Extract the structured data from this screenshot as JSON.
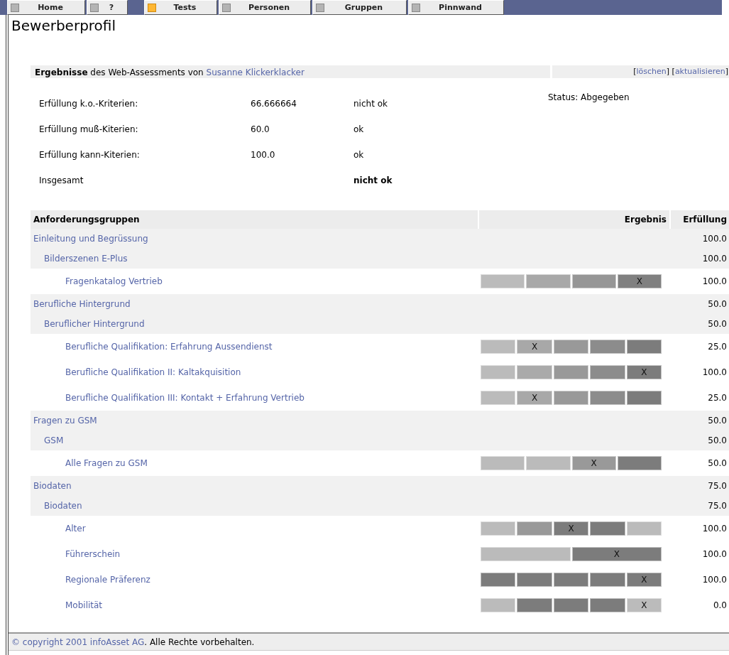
{
  "tab_groups": [
    [
      {
        "label": "Home",
        "selected": false
      },
      {
        "label": "?",
        "selected": false
      }
    ],
    [
      {
        "label": "Tests",
        "selected": true
      },
      {
        "label": "Personen",
        "selected": false
      },
      {
        "label": "Gruppen",
        "selected": false
      },
      {
        "label": "Pinnwand",
        "selected": false
      }
    ]
  ],
  "title": "Bewerberprofil",
  "result_header": {
    "intro": "**Ergebnisse** des Web-Assessments von ",
    "person": "Susanne Klickerklacker",
    "actions": [
      {
        "open": "[",
        "label": "löschen",
        "close": "]"
      },
      {
        "open": "[",
        "label": "aktualisieren",
        "close": "]"
      }
    ]
  },
  "summary": [
    {
      "kind": "criterion",
      "label": "Erfüllung k.o.-Kriterien:",
      "value": "66.666664",
      "verdict": "nicht ok"
    },
    {
      "kind": "criterion",
      "label": "Erfüllung muß-Kiterien:",
      "value": "60.0",
      "verdict": "ok"
    },
    {
      "kind": "criterion",
      "label": "Erfüllung kann-Kiterien:",
      "value": "100.0",
      "verdict": "ok"
    },
    {
      "kind": "total",
      "label": "Insgesamt",
      "verdict": "nicht ok"
    }
  ],
  "status": "Status: Abgegeben",
  "table": {
    "columns": [
      "Anforderungsgruppen",
      "Ergebnis",
      "Erfüllung"
    ],
    "rows": [
      {
        "name": "Einleitung und Begrüssung",
        "score": "100.0",
        "children": [
          {
            "name": "Bilderszenen E-Plus",
            "score": "100.0",
            "children": [
              {
                "name": "Fragenkatalog Vertrieb",
                "score": "100.0",
                "scale": [
                  {
                    "color": "#bbbbbb"
                  },
                  {
                    "color": "#a8a8a8"
                  },
                  {
                    "color": "#969696"
                  },
                  {
                    "color": "#808080",
                    "mark": "X"
                  }
                ]
              }
            ]
          }
        ]
      },
      {
        "name": "Berufliche Hintergrund",
        "score": "50.0",
        "children": [
          {
            "name": "Beruflicher Hintergrund",
            "score": "50.0",
            "children": [
              {
                "name": "Berufliche Qualifikation: Erfahrung Aussendienst",
                "score": "25.0",
                "scale": [
                  {
                    "color": "#bbbbbb"
                  },
                  {
                    "color": "#a8a8a8",
                    "mark": "X"
                  },
                  {
                    "color": "#999999"
                  },
                  {
                    "color": "#8c8c8c"
                  },
                  {
                    "color": "#7c7c7c"
                  }
                ]
              },
              {
                "name": "Berufliche Qualifikation II: Kaltakquisition",
                "score": "100.0",
                "scale": [
                  {
                    "color": "#bbbbbb"
                  },
                  {
                    "color": "#aaaaaa"
                  },
                  {
                    "color": "#999999"
                  },
                  {
                    "color": "#8c8c8c"
                  },
                  {
                    "color": "#7c7c7c",
                    "mark": "X"
                  }
                ]
              },
              {
                "name": "Berufliche Qualifikation III: Kontakt + Erfahrung Vertrieb",
                "score": "25.0",
                "scale": [
                  {
                    "color": "#bbbbbb"
                  },
                  {
                    "color": "#a8a8a8",
                    "mark": "X"
                  },
                  {
                    "color": "#999999"
                  },
                  {
                    "color": "#8c8c8c"
                  },
                  {
                    "color": "#7c7c7c"
                  }
                ]
              }
            ]
          }
        ]
      },
      {
        "name": "Fragen zu GSM",
        "score": "50.0",
        "children": [
          {
            "name": "GSM",
            "score": "50.0",
            "children": [
              {
                "name": "Alle Fragen zu GSM",
                "score": "50.0",
                "scale": [
                  {
                    "color": "#bbbbbb"
                  },
                  {
                    "color": "#bbbbbb"
                  },
                  {
                    "color": "#999999",
                    "mark": "X"
                  },
                  {
                    "color": "#7c7c7c"
                  }
                ]
              }
            ]
          }
        ]
      },
      {
        "name": "Biodaten",
        "score": "75.0",
        "children": [
          {
            "name": "Biodaten",
            "score": "75.0",
            "children": [
              {
                "name": "Alter",
                "score": "100.0",
                "scale": [
                  {
                    "color": "#bbbbbb"
                  },
                  {
                    "color": "#999999"
                  },
                  {
                    "color": "#7c7c7c",
                    "mark": "X"
                  },
                  {
                    "color": "#7c7c7c"
                  },
                  {
                    "color": "#bbbbbb"
                  }
                ]
              },
              {
                "name": "Führerschein",
                "score": "100.0",
                "scale": [
                  {
                    "color": "#bbbbbb"
                  },
                  {
                    "color": "#7c7c7c",
                    "mark": "X"
                  }
                ]
              },
              {
                "name": "Regionale Präferenz",
                "score": "100.0",
                "scale": [
                  {
                    "color": "#7c7c7c"
                  },
                  {
                    "color": "#7c7c7c"
                  },
                  {
                    "color": "#7c7c7c"
                  },
                  {
                    "color": "#7c7c7c"
                  },
                  {
                    "color": "#7c7c7c",
                    "mark": "X"
                  }
                ]
              },
              {
                "name": "Mobilität",
                "score": "0.0",
                "scale": [
                  {
                    "color": "#bbbbbb"
                  },
                  {
                    "color": "#7c7c7c"
                  },
                  {
                    "color": "#7c7c7c"
                  },
                  {
                    "color": "#7c7c7c"
                  },
                  {
                    "color": "#bbbbbb",
                    "mark": "X"
                  }
                ]
              }
            ]
          }
        ]
      }
    ]
  },
  "footer": {
    "link": "© copyright 2001 infoAsset AG",
    "text": ". Alle Rechte vorbehalten."
  }
}
